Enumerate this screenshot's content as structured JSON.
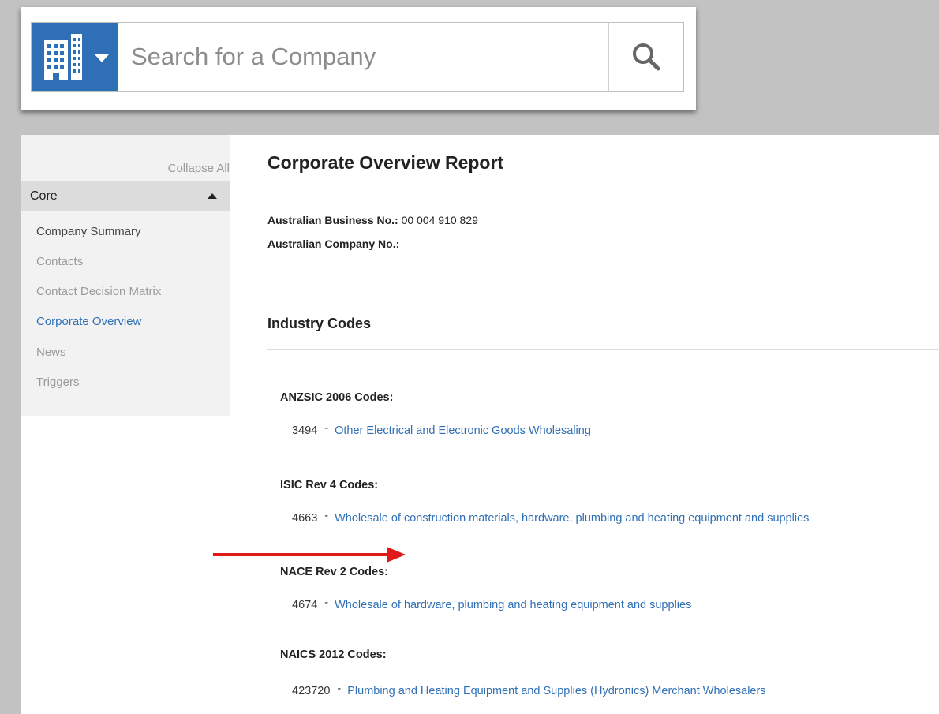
{
  "search": {
    "placeholder": "Search for a Company",
    "type_icon": "building-icon",
    "search_icon": "magnifier-icon"
  },
  "sidebar": {
    "collapse_label": "Collapse All",
    "group_label": "Core",
    "items": [
      {
        "label": "Company Summary",
        "state": "enabled"
      },
      {
        "label": "Contacts",
        "state": "disabled"
      },
      {
        "label": "Contact Decision Matrix",
        "state": "disabled"
      },
      {
        "label": "Corporate Overview",
        "state": "active"
      },
      {
        "label": "News",
        "state": "disabled"
      },
      {
        "label": "Triggers",
        "state": "disabled"
      }
    ]
  },
  "report": {
    "title": "Corporate Overview Report",
    "abn_label": "Australian Business No.:",
    "abn_value": "00 004 910 829",
    "acn_label": "Australian Company No.:",
    "acn_value": "",
    "section_title": "Industry Codes",
    "code_groups": [
      {
        "heading": "ANZSIC 2006 Codes:",
        "code": "3494",
        "separator": "-",
        "description": "Other Electrical and Electronic Goods Wholesaling"
      },
      {
        "heading": "ISIC Rev 4 Codes:",
        "code": "4663",
        "separator": "-",
        "description": "Wholesale of construction materials, hardware, plumbing and heating equipment and supplies"
      },
      {
        "heading": "NACE Rev 2 Codes:",
        "code": "4674",
        "separator": "-",
        "description": "Wholesale of hardware, plumbing and heating equipment and supplies"
      },
      {
        "heading": "NAICS 2012 Codes:",
        "code": "423720",
        "separator": "-",
        "description": "Plumbing and Heating Equipment and Supplies (Hydronics) Merchant Wholesalers"
      }
    ]
  },
  "colors": {
    "accent": "#2f6fb6",
    "annotation_arrow": "#e01919",
    "backdrop": "#c2c2c2"
  }
}
